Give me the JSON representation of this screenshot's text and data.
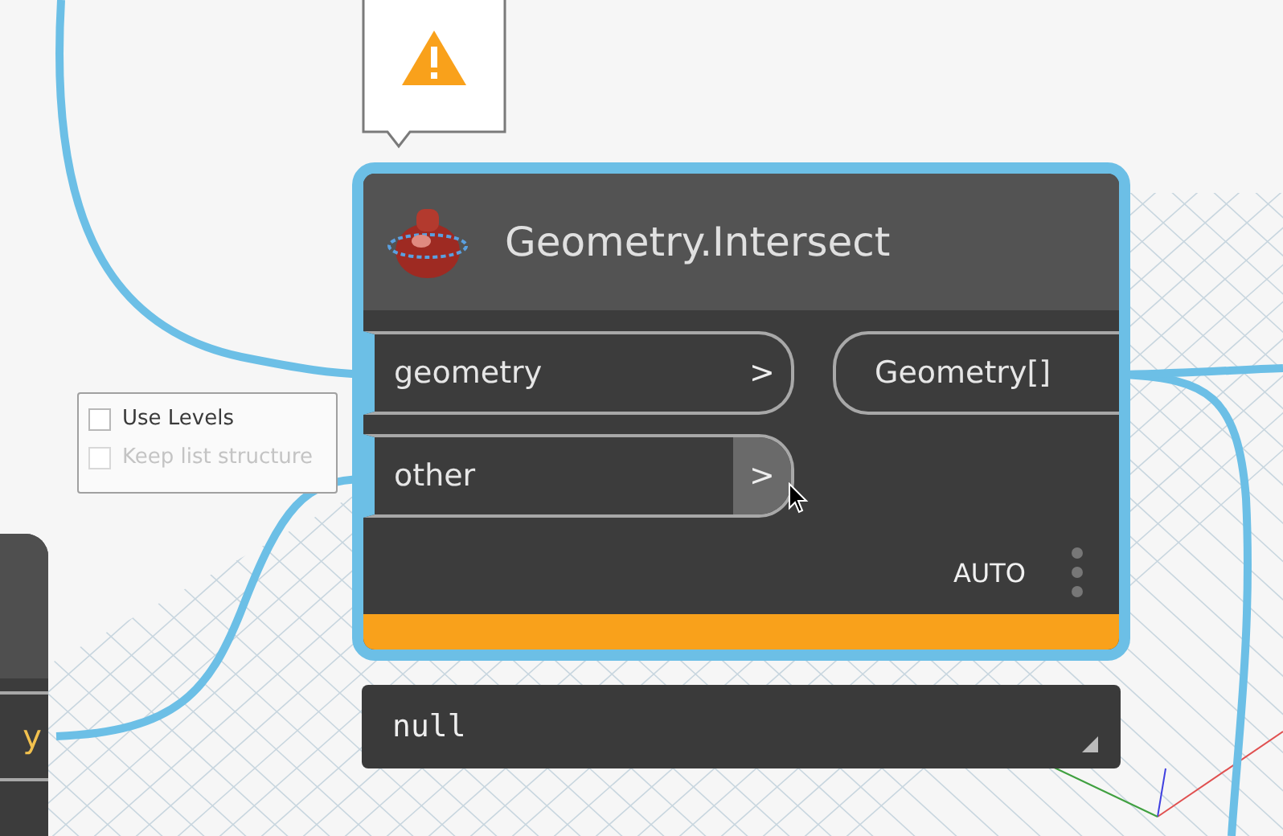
{
  "node": {
    "title": "Geometry.Intersect",
    "selected": true,
    "warning": true,
    "inputs": [
      {
        "label": "geometry",
        "arrow": ">",
        "hovered": false
      },
      {
        "label": "other",
        "arrow": ">",
        "hovered": true
      }
    ],
    "outputs": [
      {
        "label": "Geometry[]"
      }
    ],
    "lacing": "AUTO"
  },
  "preview": {
    "value": "null"
  },
  "port_menu": {
    "items": [
      {
        "label": "Use Levels",
        "checked": false,
        "disabled": false
      },
      {
        "label": "Keep list structure",
        "checked": false,
        "disabled": true
      }
    ]
  },
  "partial_node": {
    "port_label": "y"
  }
}
